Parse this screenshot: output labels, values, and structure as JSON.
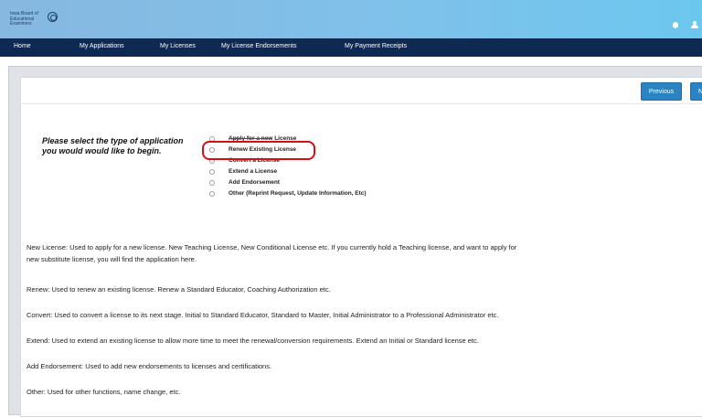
{
  "header": {
    "logo_line1": "Iowa Board of",
    "logo_line2": "Educational",
    "logo_line3": "Examiners"
  },
  "nav": {
    "items": [
      "Home",
      "My Applications",
      "My Licenses",
      "My License Endorsements",
      "My Payment Receipts"
    ]
  },
  "toolbar": {
    "previous_label": "Previous",
    "next_label": "N"
  },
  "form": {
    "prompt_line1": "Please select the type of application",
    "prompt_line2": "you would would like to begin.",
    "options": [
      "Apply for a new License",
      "Renew Existing License",
      "Convert a License",
      "Extend a License",
      "Add Endorsement",
      "Other (Reprint Request, Update Information, Etc)"
    ]
  },
  "descriptions": {
    "new_line1": "New License: Used to apply for a new license. New Teaching License, New Conditional License etc. If you currently hold a Teaching license, and want to apply for",
    "new_line2": "new substitute license, you will find the application here.",
    "renew": "Renew: Used to renew an existing license. Renew a Standard Educator, Coaching Authorization etc.",
    "convert": "Convert: Used to convert a license to its next stage. Initial to Standard Educator, Standard to Master, Initial Administrator to a Professional Administrator etc.",
    "extend": "Extend: Used to extend an existing license to allow more time to meet the renewal/conversion requirements. Extend an Initial or Standard license etc.",
    "add_endorsement": "Add Endorsement: Used to add new endorsements to licenses and certifications.",
    "other": "Other: Used for other functions, name change, etc."
  },
  "colors": {
    "nav_bg": "#0f2a52",
    "button_bg": "#2a83c2",
    "highlight": "#d80e16"
  }
}
